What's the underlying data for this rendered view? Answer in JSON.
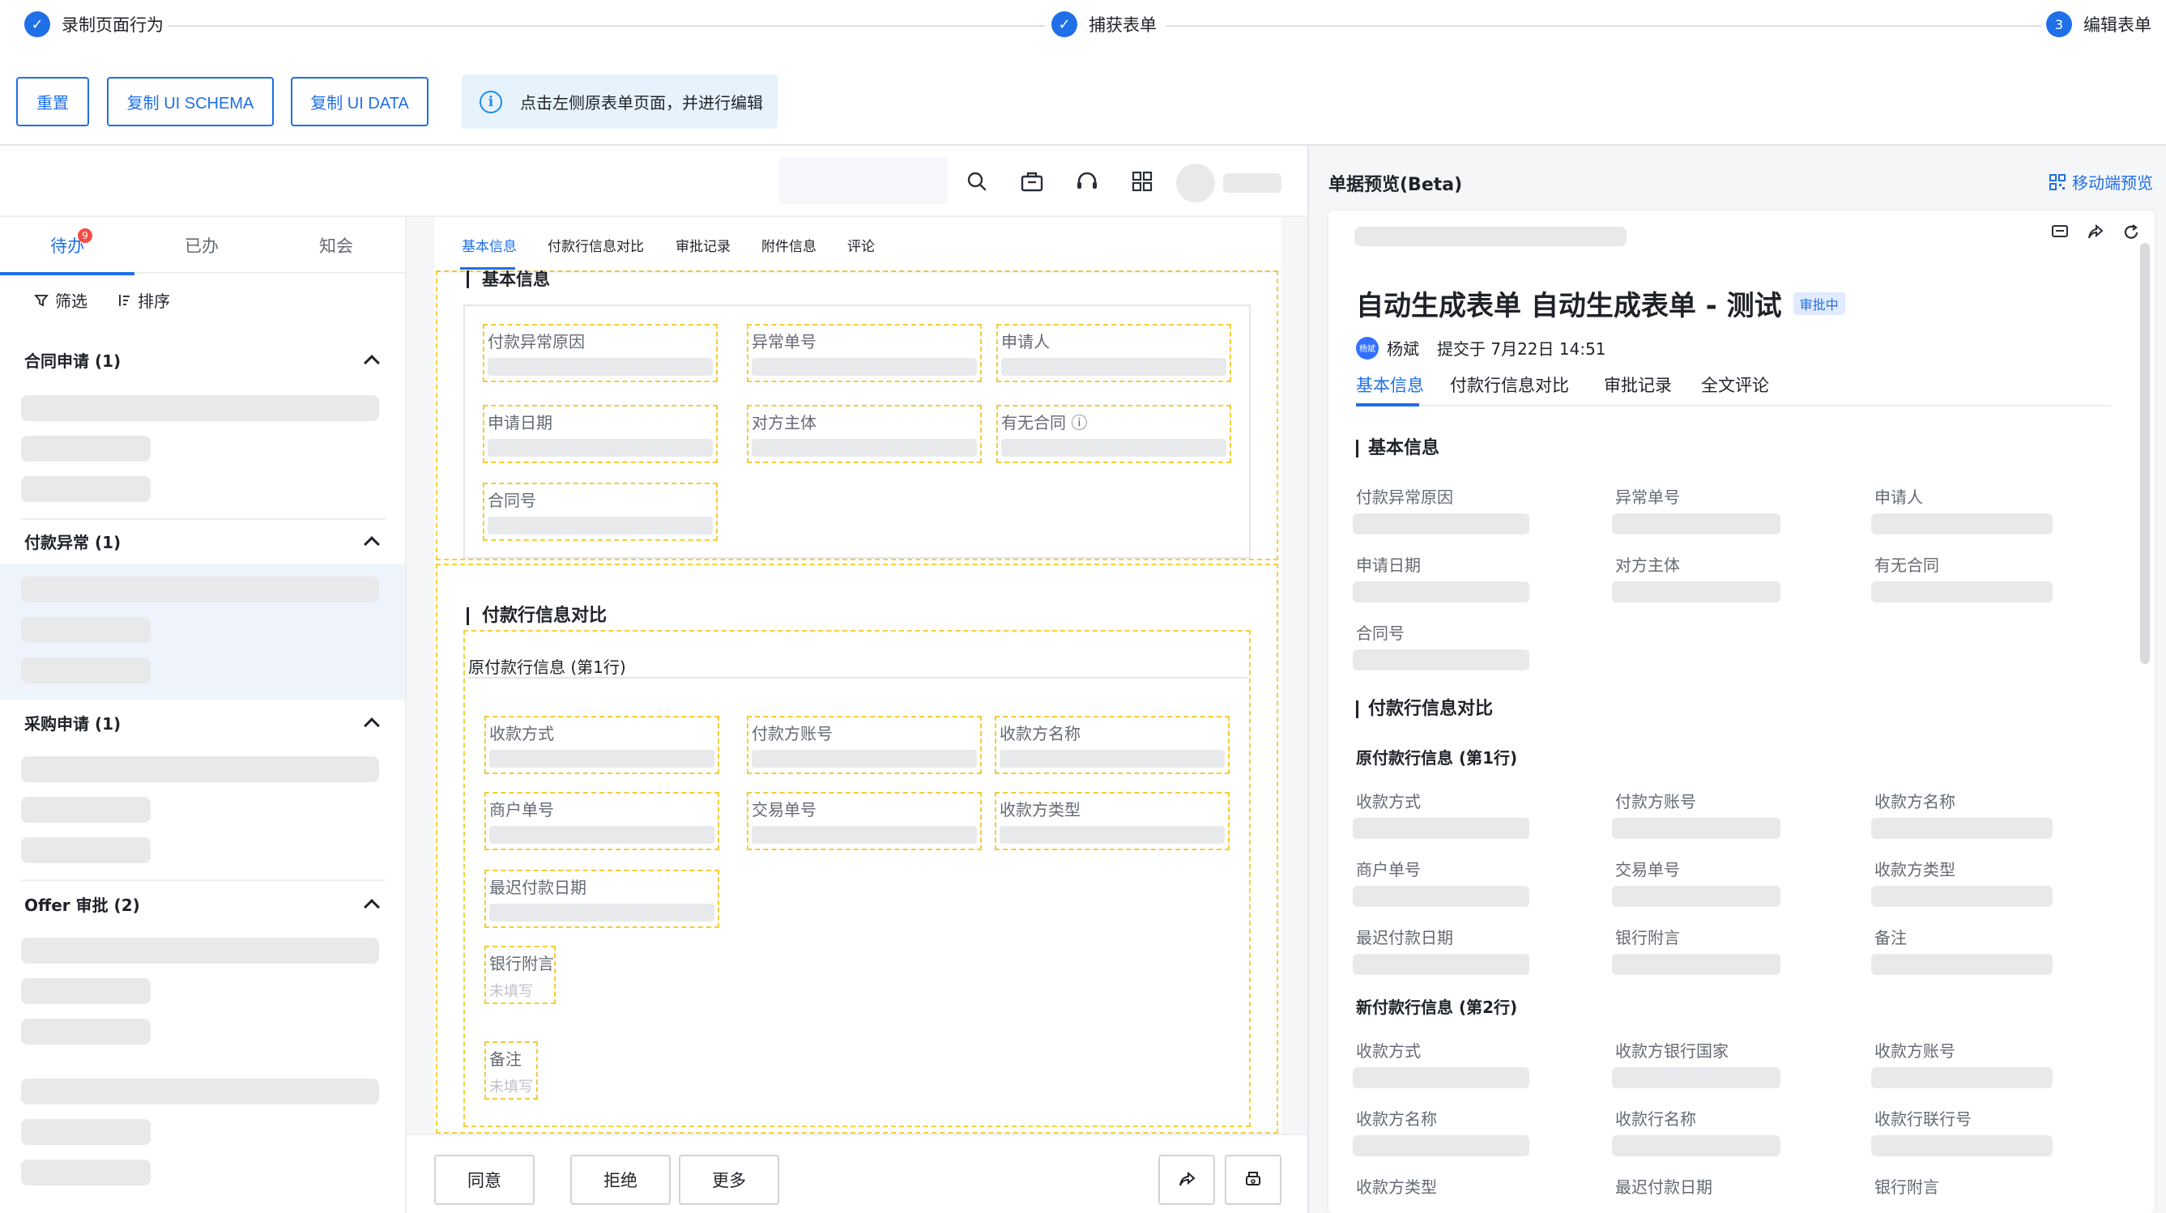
{
  "stepper": {
    "steps": [
      {
        "label": "录制页面行为",
        "mark": "✓"
      },
      {
        "label": "捕获表单",
        "mark": "✓"
      },
      {
        "label": "编辑表单",
        "mark": "3"
      }
    ]
  },
  "toolbar": {
    "reset_label": "重置",
    "copy_schema_label": "复制 UI SCHEMA",
    "copy_data_label": "复制 UI DATA",
    "hint_text": "点击左侧原表单页面，并进行编辑",
    "hint_icon": "info-icon"
  },
  "app_header": {
    "icons": [
      "search-icon",
      "toolbox-icon",
      "headset-icon",
      "grid-apps-icon"
    ]
  },
  "sidebar": {
    "tabs": [
      {
        "label": "待办",
        "badge": "9"
      },
      {
        "label": "已办"
      },
      {
        "label": "知会"
      }
    ],
    "filter_label": "筛选",
    "sort_label": "排序",
    "groups": [
      {
        "title": "合同申请 (1)"
      },
      {
        "title": "付款异常 (1)"
      },
      {
        "title": "采购申请 (1)"
      },
      {
        "title": "Offer 审批 (2)"
      }
    ]
  },
  "form": {
    "tabs": [
      "基本信息",
      "付款行信息对比",
      "审批记录",
      "附件信息",
      "评论"
    ],
    "basic_section_title": "基本信息",
    "basic_fields": [
      "付款异常原因",
      "异常单号",
      "申请人",
      "申请日期",
      "对方主体",
      "有无合同",
      "合同号"
    ],
    "has_contract_info_icon": "ⓘ",
    "compare_section_title": "付款行信息对比",
    "orig_sub_title": "原付款行信息 (第1行)",
    "orig_fields": [
      "收款方式",
      "付款方账号",
      "收款方名称",
      "商户单号",
      "交易单号",
      "收款方类型",
      "最迟付款日期"
    ],
    "bank_note_label": "银行附言",
    "remark_label": "备注",
    "empty_text": "未填写"
  },
  "action_bar": {
    "agree_label": "同意",
    "reject_label": "拒绝",
    "more_label": "更多",
    "icons": [
      "share-icon",
      "print-icon"
    ]
  },
  "preview": {
    "title": "单据预览(Beta)",
    "mobile_preview_label": "移动端预览",
    "doc_title": "自动生成表单  自动生成表单 - 测试",
    "status": "审批中",
    "avatar_text": "杨斌",
    "submitter": "杨斌",
    "submit_time": "提交于 7月22日 14:51",
    "tabs": [
      "基本信息",
      "付款行信息对比",
      "审批记录",
      "全文评论"
    ],
    "basic_section": "基本信息",
    "basic_fields": [
      "付款异常原因",
      "异常单号",
      "申请人",
      "申请日期",
      "对方主体",
      "有无合同",
      "合同号"
    ],
    "compare_section": "付款行信息对比",
    "orig_sub": "原付款行信息 (第1行)",
    "orig_fields": [
      "收款方式",
      "付款方账号",
      "收款方名称",
      "商户单号",
      "交易单号",
      "收款方类型",
      "最迟付款日期",
      "银行附言",
      "备注"
    ],
    "new_sub": "新付款行信息 (第2行)",
    "new_fields": [
      "收款方式",
      "收款方银行国家",
      "收款方账号",
      "收款方名称",
      "收款行名称",
      "收款行联行号",
      "收款方类型",
      "最迟付款日期",
      "银行附言"
    ]
  }
}
